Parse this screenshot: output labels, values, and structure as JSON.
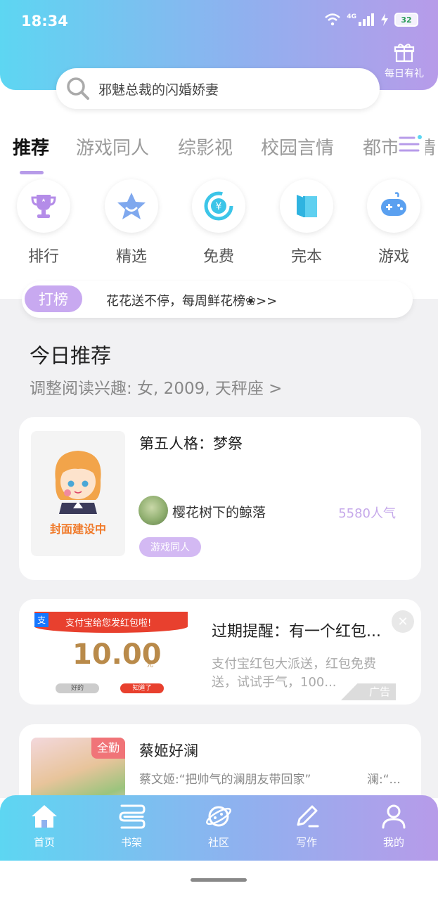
{
  "status_bar": {
    "time": "18:34",
    "network": "4G",
    "battery": "32"
  },
  "header": {
    "gift_label": "每日有礼",
    "search_placeholder": "邪魅总裁的闪婚娇妻"
  },
  "tabs": [
    "推荐",
    "游戏同人",
    "综影视",
    "校园言情",
    "都市言情"
  ],
  "categories": [
    {
      "label": "排行",
      "icon": "trophy-icon"
    },
    {
      "label": "精选",
      "icon": "star-icon"
    },
    {
      "label": "免费",
      "icon": "yen-coin-icon"
    },
    {
      "label": "完本",
      "icon": "book-icon"
    },
    {
      "label": "游戏",
      "icon": "gamepad-icon"
    }
  ],
  "notice": {
    "badge": "打榜",
    "text": "花花送不停，每周鲜花榜❀>>"
  },
  "recommend": {
    "title": "今日推荐",
    "subtitle": "调整阅读兴趣: 女, 2009, 天秤座 >"
  },
  "book1": {
    "title": "第五人格：梦祭",
    "cover_text": "封面建设中",
    "author": "樱花树下的鲸落",
    "popularity": "5580人气",
    "tag": "游戏同人"
  },
  "ad": {
    "img_header": "支付宝给您发红包啦!",
    "img_amount": "10.00",
    "img_unit": "元",
    "img_btn_ok": "好的",
    "img_btn_know": "知道了",
    "title": "过期提醒：有一个红包...",
    "desc": "支付宝红包大派送，红包免费送，试试手气，100...",
    "badge": "广告"
  },
  "book2": {
    "title": "蔡姬好澜",
    "badge": "全勤",
    "desc": "蔡文姬:“把帅气的澜朋友带回家”",
    "desc2": "澜:“..."
  },
  "bottom_nav": [
    {
      "label": "首页",
      "icon": "home-icon"
    },
    {
      "label": "书架",
      "icon": "bookshelf-icon"
    },
    {
      "label": "社区",
      "icon": "planet-icon"
    },
    {
      "label": "写作",
      "icon": "pen-icon"
    },
    {
      "label": "我的",
      "icon": "user-icon"
    }
  ],
  "colors": {
    "accent": "#b79be9",
    "gradient_start": "#5dd6f2",
    "gradient_end": "#b79be9"
  }
}
